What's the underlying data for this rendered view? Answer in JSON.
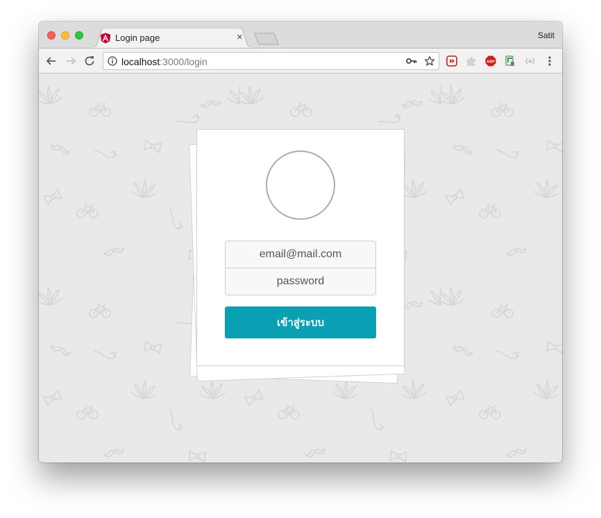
{
  "window": {
    "profile_name": "Satit",
    "tab": {
      "title": "Login page",
      "close_glyph": "×",
      "icon": "angular-icon"
    }
  },
  "toolbar": {
    "url_host": "localhost",
    "url_path": ":3000/login",
    "icons": [
      "back-arrow-icon",
      "forward-arrow-icon",
      "reload-icon",
      "info-icon",
      "key-icon",
      "star-icon",
      "menu-dots-icon"
    ],
    "extensions": [
      {
        "name": "red-extension-icon",
        "color": "#d93025"
      },
      {
        "name": "puzzle-extension-icon",
        "color": "#c9c9c9"
      },
      {
        "name": "adblock-plus-icon",
        "label": "ABP",
        "color": "#d11a1a"
      },
      {
        "name": "green-extension-icon",
        "color": "#3c9a5f"
      },
      {
        "name": "json-viewer-icon",
        "label": "{≡}",
        "color": "#9a9a9a"
      }
    ],
    "extension_abp_label": "ABP",
    "extension_json_label": "{≡}"
  },
  "login": {
    "email_placeholder": "email@mail.com",
    "password_placeholder": "password",
    "submit_label": "เข้าสู่ระบบ"
  },
  "colors": {
    "accent": "#09a0b4",
    "page_background": "#e9e9e9",
    "pattern": "#d9d9d9"
  }
}
